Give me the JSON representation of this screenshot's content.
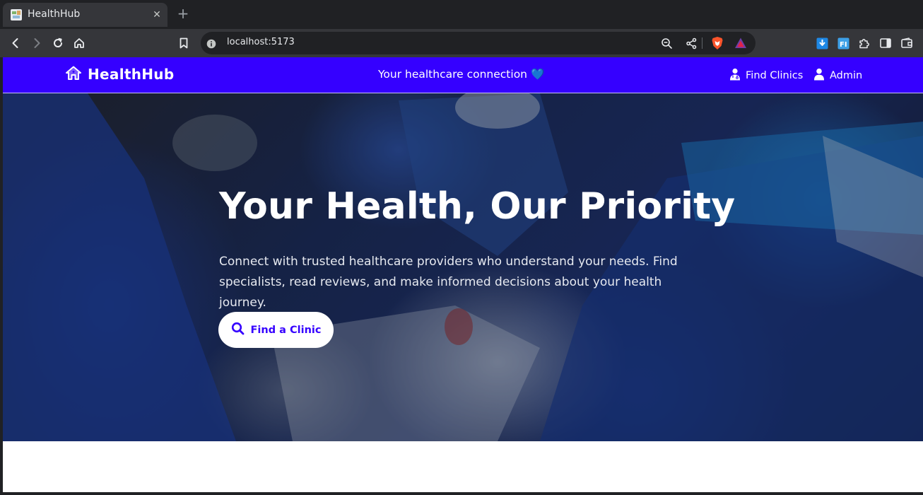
{
  "browser": {
    "tab": {
      "title": "HealthHub",
      "close_glyph": "✕"
    },
    "new_tab_glyph": "+",
    "address_bar": {
      "url": "localhost:5173"
    },
    "icons": {
      "back": "back-arrow-icon",
      "forward": "forward-arrow-icon",
      "reload": "reload-icon",
      "home": "home-icon",
      "bookmark": "bookmark-icon",
      "site_info": "info-icon",
      "zoom": "zoom-out-icon",
      "share": "share-icon",
      "brave_shield": "brave-shield-icon",
      "brave_rewards": "brave-rewards-icon",
      "extensions": [
        "download-extension-icon",
        "fi-extension-icon",
        "puzzle-extensions-icon",
        "sidebar-icon",
        "wallet-icon"
      ]
    }
  },
  "nav": {
    "brand": "HealthHub",
    "tagline": "Your healthcare connection",
    "tagline_emoji": "💙",
    "links": [
      {
        "label": "Find Clinics",
        "icon": "doctor-icon"
      },
      {
        "label": "Admin",
        "icon": "user-icon"
      }
    ],
    "bg_color": "#3500ff"
  },
  "hero": {
    "headline": "Your Health, Our Priority",
    "subtitle": "Connect with trusted healthcare providers who understand your needs. Find specialists, read reviews, and make informed decisions about your health journey.",
    "cta": {
      "label": "Find a Clinic",
      "icon": "search-icon"
    },
    "accent_color": "#3500ff"
  }
}
